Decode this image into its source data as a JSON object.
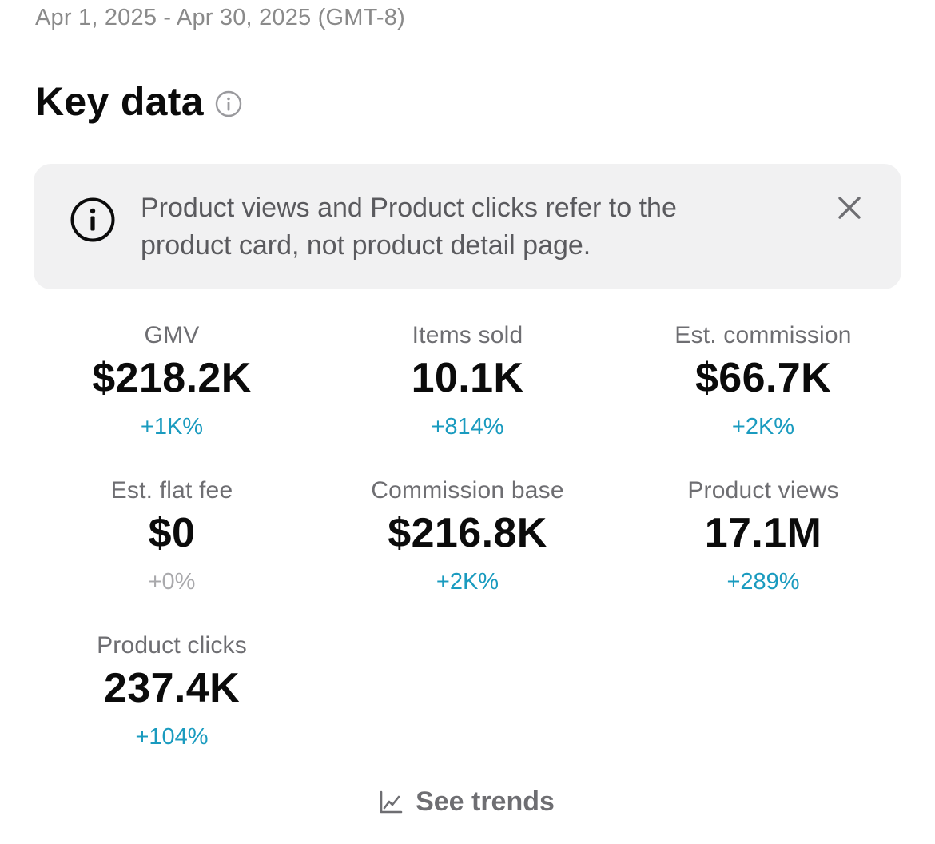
{
  "date_range": "Apr 1, 2025 - Apr 30, 2025 (GMT-8)",
  "section": {
    "title": "Key data",
    "info_icon": "info-circle-icon"
  },
  "banner": {
    "icon": "info-circle-icon",
    "text_line1": "Product views and Product clicks refer to the",
    "text_line2": "product card, not product detail page.",
    "close_icon": "close-icon"
  },
  "metrics": [
    {
      "label": "GMV",
      "value": "$218.2K",
      "change": "+1K%",
      "trend": "up"
    },
    {
      "label": "Items sold",
      "value": "10.1K",
      "change": "+814%",
      "trend": "up"
    },
    {
      "label": "Est. commission",
      "value": "$66.7K",
      "change": "+2K%",
      "trend": "up"
    },
    {
      "label": "Est. flat fee",
      "value": "$0",
      "change": "+0%",
      "trend": "neutral"
    },
    {
      "label": "Commission base",
      "value": "$216.8K",
      "change": "+2K%",
      "trend": "up"
    },
    {
      "label": "Product views",
      "value": "17.1M",
      "change": "+289%",
      "trend": "up"
    },
    {
      "label": "Product clicks",
      "value": "237.4K",
      "change": "+104%",
      "trend": "up"
    }
  ],
  "trends_link": {
    "icon": "line-chart-icon",
    "label": "See trends"
  },
  "colors": {
    "positive_change": "#1a9bbf",
    "neutral_change": "#a9a9ac",
    "banner_background": "#f1f1f2"
  }
}
